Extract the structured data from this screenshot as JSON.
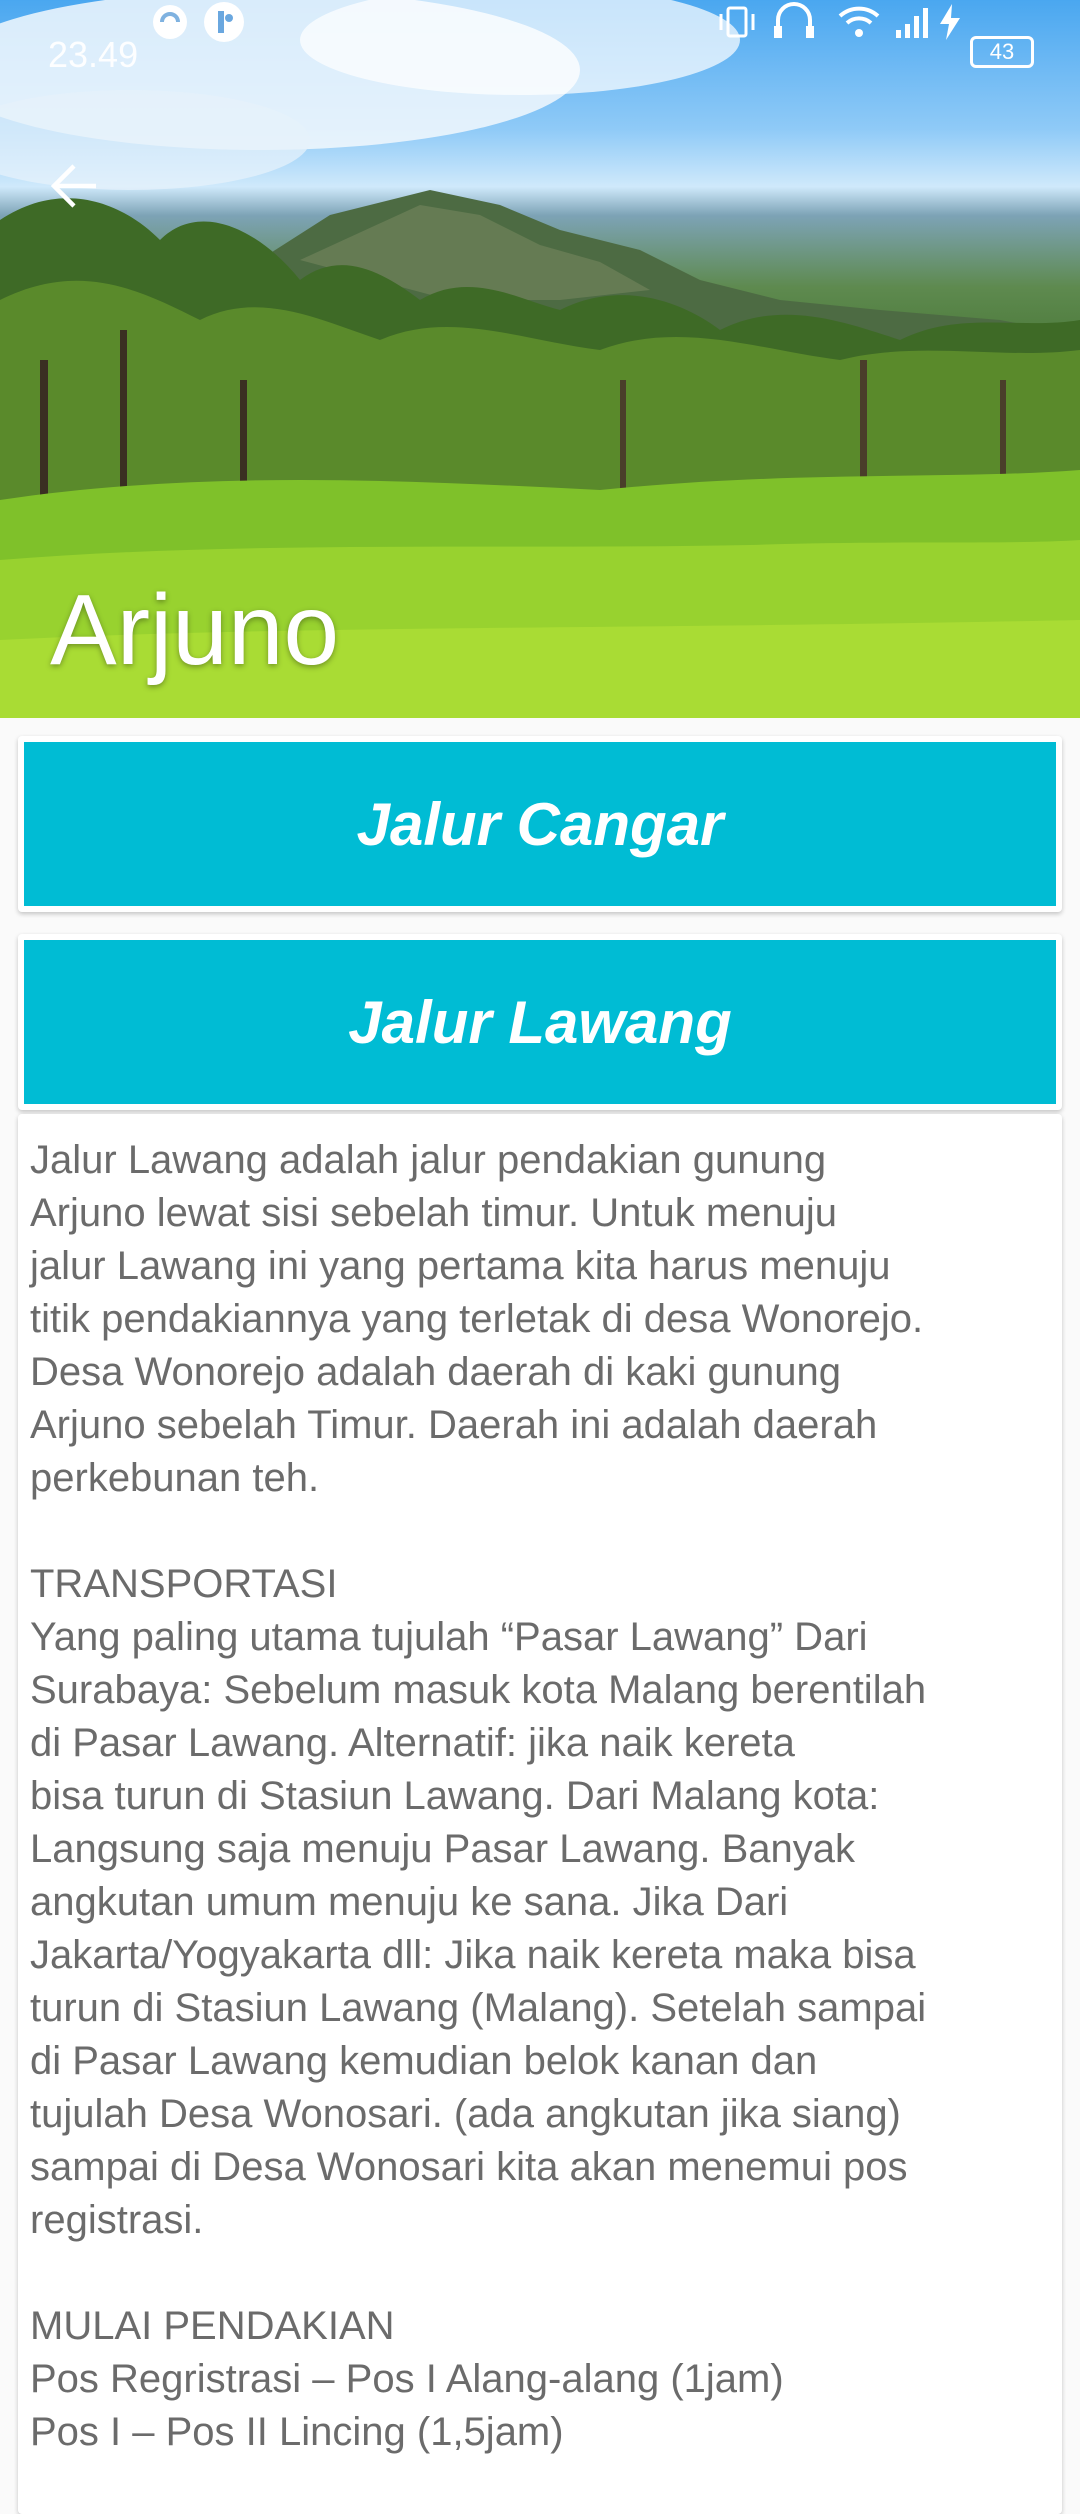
{
  "status_bar": {
    "time": "23.49",
    "battery": "43",
    "icons": [
      "data-saver-icon",
      "notification-app-icon",
      "vibrate-icon",
      "headset-icon",
      "wifi-icon",
      "signal-icon",
      "charging-icon",
      "battery-icon"
    ]
  },
  "header": {
    "back_icon": "arrow-left-icon",
    "title": "Arjuno"
  },
  "routes": [
    {
      "label": "Jalur Cangar"
    },
    {
      "label": "Jalur Lawang"
    }
  ],
  "colors": {
    "route_button": "#00bcd4",
    "body_text": "#6b6b6b",
    "card_bg": "#ffffff"
  },
  "content": {
    "text": "Jalur Lawang adalah jalur pendakian gunung\nArjuno lewat sisi sebelah timur. Untuk menuju\njalur Lawang ini yang pertama kita harus menuju\ntitik pendakiannya yang terletak di desa Wonorejo.\nDesa Wonorejo adalah daerah di kaki gunung\nArjuno sebelah Timur. Daerah ini adalah daerah\nperkebunan teh.\n\nTRANSPORTASI\nYang paling utama tujulah “Pasar Lawang” Dari\nSurabaya: Sebelum masuk kota Malang berentilah\ndi Pasar Lawang. Alternatif: jika naik kereta\nbisa turun di Stasiun Lawang. Dari Malang kota:\nLangsung saja menuju Pasar Lawang. Banyak\nangkutan umum menuju ke sana. Jika Dari\nJakarta/Yogyakarta dll: Jika naik kereta maka bisa\nturun di Stasiun Lawang (Malang). Setelah sampai\ndi Pasar Lawang kemudian belok kanan dan\ntujulah Desa Wonosari. (ada angkutan jika siang)\nsampai di Desa Wonosari kita akan menemui pos\nregistrasi.\n\nMULAI PENDAKIAN\n Pos Regristrasi – Pos I Alang-alang (1jam)\n Pos I – Pos II Lincing (1,5jam)"
  }
}
